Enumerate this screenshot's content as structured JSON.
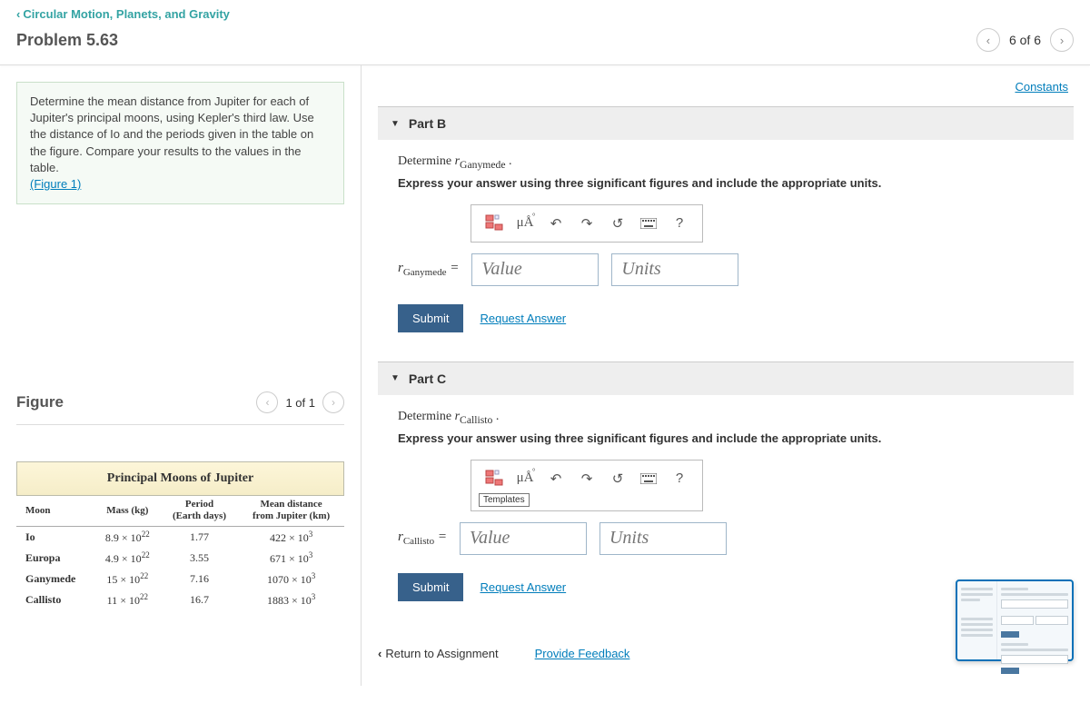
{
  "breadcrumb": "Circular Motion, Planets, and Gravity",
  "problem_title": "Problem 5.63",
  "pager": {
    "label": "6 of 6"
  },
  "constants": "Constants",
  "prompt": {
    "text": "Determine the mean distance from Jupiter for each of Jupiter's principal moons, using Kepler's third law. Use the distance of Io and the periods given in the table on the figure. Compare your results to the values in the table.",
    "figure_link": "(Figure 1)"
  },
  "figure": {
    "title": "Figure",
    "pager": "1 of 1"
  },
  "table": {
    "title": "Principal Moons of Jupiter",
    "headers": [
      "Moon",
      "Mass (kg)",
      "Period (Earth days)",
      "Mean distance from Jupiter (km)"
    ],
    "rows": [
      {
        "moon": "Io",
        "mass_coeff": "8.9",
        "period": "1.77",
        "dist_coeff": "422"
      },
      {
        "moon": "Europa",
        "mass_coeff": "4.9",
        "period": "3.55",
        "dist_coeff": "671"
      },
      {
        "moon": "Ganymede",
        "mass_coeff": "15",
        "period": "7.16",
        "dist_coeff": "1070"
      },
      {
        "moon": "Callisto",
        "mass_coeff": "11",
        "period": "16.7",
        "dist_coeff": "1883"
      }
    ]
  },
  "parts": {
    "b": {
      "heading": "Part B",
      "determine_pre": "Determine ",
      "var": "r",
      "sub": "Ganymede",
      "instruction": "Express your answer using three significant figures and include the appropriate units.",
      "lhs_var": "r",
      "lhs_sub": "Ganymede",
      "eq": " = ",
      "value_ph": "Value",
      "units_ph": "Units",
      "submit": "Submit",
      "request": "Request Answer"
    },
    "c": {
      "heading": "Part C",
      "determine_pre": "Determine ",
      "var": "r",
      "sub": "Callisto",
      "instruction": "Express your answer using three significant figures and include the appropriate units.",
      "lhs_var": "r",
      "lhs_sub": "Callisto",
      "eq": " = ",
      "value_ph": "Value",
      "units_ph": "Units",
      "submit": "Submit",
      "request": "Request Answer",
      "templates_label": "Templates"
    }
  },
  "toolbar": {
    "mua": "μÅ",
    "help": "?"
  },
  "footer": {
    "return": "Return to Assignment",
    "feedback": "Provide Feedback"
  }
}
